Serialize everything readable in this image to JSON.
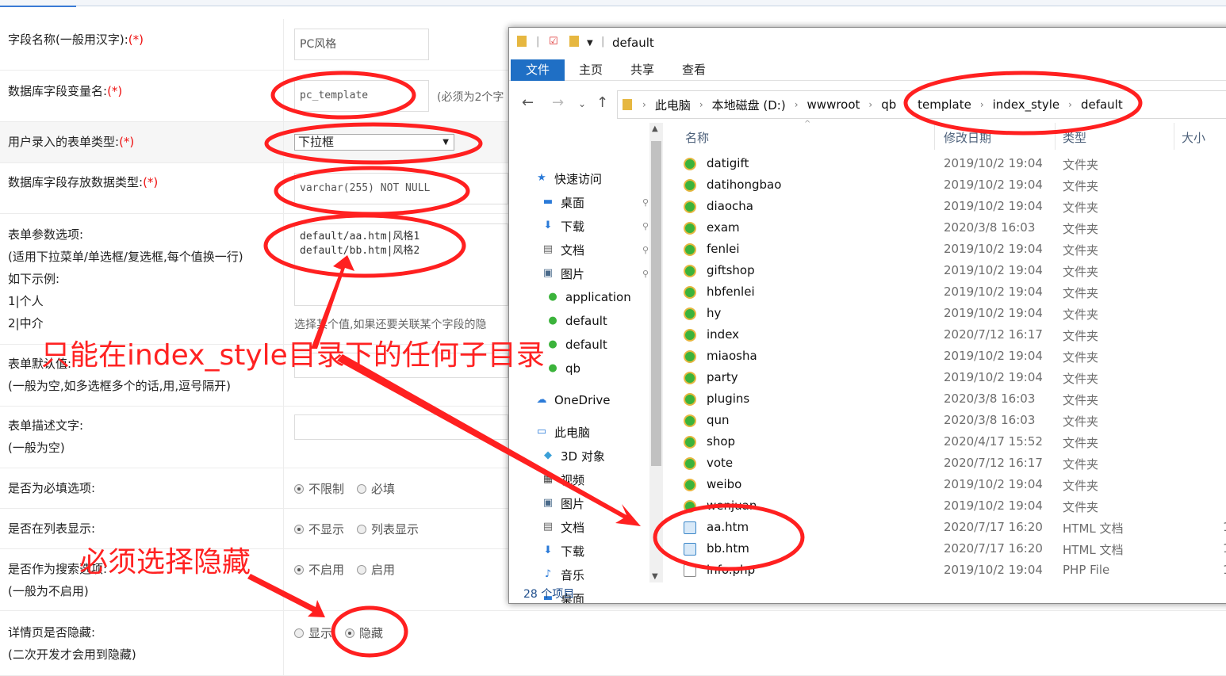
{
  "form": {
    "field_name": {
      "label": "字段名称(一般用汉字):",
      "req": "(*)",
      "value": "PC风格"
    },
    "db_var": {
      "label": "数据库字段变量名:",
      "req": "(*)",
      "value": "pc_template",
      "hint": "(必须为2个字"
    },
    "input_type": {
      "label": "用户录入的表单类型:",
      "req": "(*)",
      "value": "下拉框"
    },
    "db_type": {
      "label": "数据库字段存放数据类型:",
      "req": "(*)",
      "value": "varchar(255) NOT NULL"
    },
    "options": {
      "label": "表单参数选项:",
      "hints": [
        "(适用下拉菜单/单选框/复选框,每个值换一行)",
        "如下示例:",
        "1|个人",
        "2|中介"
      ],
      "value": "default/aa.htm|风格1\ndefault/bb.htm|风格2",
      "side_hint": "选择某个值,如果还要关联某个字段的隐"
    },
    "default_value": {
      "label": "表单默认值:",
      "hint": "(一般为空,如多选框多个的话,用,逗号隔开)"
    },
    "description": {
      "label": "表单描述文字:",
      "hint": "(一般为空)"
    },
    "required": {
      "label": "是否为必填选项:",
      "opt1": "不限制",
      "opt2": "必填"
    },
    "list_show": {
      "label": "是否在列表显示:",
      "opt1": "不显示",
      "opt2": "列表显示"
    },
    "search": {
      "label": "是否作为搜索选项:",
      "hint": "(一般为不启用)",
      "opt1": "不启用",
      "opt2": "启用"
    },
    "detail_hide": {
      "label": "详情页是否隐藏:",
      "hint": "(二次开发才会用到隐藏)",
      "opt1": "显示",
      "opt2": "隐藏"
    }
  },
  "explorer": {
    "title": "default",
    "tabs": [
      "文件",
      "主页",
      "共享",
      "查看"
    ],
    "breadcrumb": [
      "此电脑",
      "本地磁盘 (D:)",
      "wwwroot",
      "qb",
      "template",
      "index_style",
      "default"
    ],
    "nav": [
      {
        "label": "快速访问",
        "icon": "star-icon",
        "pin": false
      },
      {
        "label": "桌面",
        "icon": "desktop-icon",
        "pin": true
      },
      {
        "label": "下载",
        "icon": "download-icon",
        "pin": true
      },
      {
        "label": "文档",
        "icon": "document-icon",
        "pin": true
      },
      {
        "label": "图片",
        "icon": "picture-icon",
        "pin": true
      },
      {
        "label": "application",
        "icon": "folder-icon",
        "pin": false
      },
      {
        "label": "default",
        "icon": "folder-icon",
        "pin": false
      },
      {
        "label": "default",
        "icon": "folder-icon",
        "pin": false
      },
      {
        "label": "qb",
        "icon": "folder-icon",
        "pin": false
      },
      {
        "label": "OneDrive",
        "icon": "cloud-icon",
        "pin": false
      },
      {
        "label": "此电脑",
        "icon": "computer-icon",
        "pin": false
      },
      {
        "label": "3D 对象",
        "icon": "cube-icon",
        "pin": false
      },
      {
        "label": "视频",
        "icon": "video-icon",
        "pin": false
      },
      {
        "label": "图片",
        "icon": "picture-icon",
        "pin": false
      },
      {
        "label": "文档",
        "icon": "document-icon",
        "pin": false
      },
      {
        "label": "下载",
        "icon": "download-icon",
        "pin": false
      },
      {
        "label": "音乐",
        "icon": "music-icon",
        "pin": false
      },
      {
        "label": "桌面",
        "icon": "desktop-icon",
        "pin": false
      }
    ],
    "columns": {
      "name": "名称",
      "date": "修改日期",
      "type": "类型",
      "size": "大小"
    },
    "files": [
      {
        "name": "datigift",
        "date": "2019/10/2 19:04",
        "type": "文件夹",
        "size": "",
        "kind": "folder"
      },
      {
        "name": "datihongbao",
        "date": "2019/10/2 19:04",
        "type": "文件夹",
        "size": "",
        "kind": "folder"
      },
      {
        "name": "diaocha",
        "date": "2019/10/2 19:04",
        "type": "文件夹",
        "size": "",
        "kind": "folder"
      },
      {
        "name": "exam",
        "date": "2020/3/8 16:03",
        "type": "文件夹",
        "size": "",
        "kind": "folder"
      },
      {
        "name": "fenlei",
        "date": "2019/10/2 19:04",
        "type": "文件夹",
        "size": "",
        "kind": "folder"
      },
      {
        "name": "giftshop",
        "date": "2019/10/2 19:04",
        "type": "文件夹",
        "size": "",
        "kind": "folder"
      },
      {
        "name": "hbfenlei",
        "date": "2019/10/2 19:04",
        "type": "文件夹",
        "size": "",
        "kind": "folder"
      },
      {
        "name": "hy",
        "date": "2019/10/2 19:04",
        "type": "文件夹",
        "size": "",
        "kind": "folder"
      },
      {
        "name": "index",
        "date": "2020/7/12 16:17",
        "type": "文件夹",
        "size": "",
        "kind": "folder"
      },
      {
        "name": "miaosha",
        "date": "2019/10/2 19:04",
        "type": "文件夹",
        "size": "",
        "kind": "folder"
      },
      {
        "name": "party",
        "date": "2019/10/2 19:04",
        "type": "文件夹",
        "size": "",
        "kind": "folder"
      },
      {
        "name": "plugins",
        "date": "2020/3/8 16:03",
        "type": "文件夹",
        "size": "",
        "kind": "folder"
      },
      {
        "name": "qun",
        "date": "2020/3/8 16:03",
        "type": "文件夹",
        "size": "",
        "kind": "folder"
      },
      {
        "name": "shop",
        "date": "2020/4/17 15:52",
        "type": "文件夹",
        "size": "",
        "kind": "folder"
      },
      {
        "name": "vote",
        "date": "2020/7/12 16:17",
        "type": "文件夹",
        "size": "",
        "kind": "folder"
      },
      {
        "name": "weibo",
        "date": "2019/10/2 19:04",
        "type": "文件夹",
        "size": "",
        "kind": "folder"
      },
      {
        "name": "wenjuan",
        "date": "2019/10/2 19:04",
        "type": "文件夹",
        "size": "",
        "kind": "folder"
      },
      {
        "name": "aa.htm",
        "date": "2020/7/17 16:20",
        "type": "HTML 文档",
        "size": "1",
        "kind": "html"
      },
      {
        "name": "bb.htm",
        "date": "2020/7/17 16:20",
        "type": "HTML 文档",
        "size": "1",
        "kind": "html"
      },
      {
        "name": "info.php",
        "date": "2019/10/2 19:04",
        "type": "PHP File",
        "size": "1",
        "kind": "php"
      }
    ],
    "status": "28 个项目"
  },
  "annotations": {
    "note1": "只能在index_style目录下的任何子目录",
    "note2": "必须选择隐藏",
    "color": "#ff2020"
  }
}
